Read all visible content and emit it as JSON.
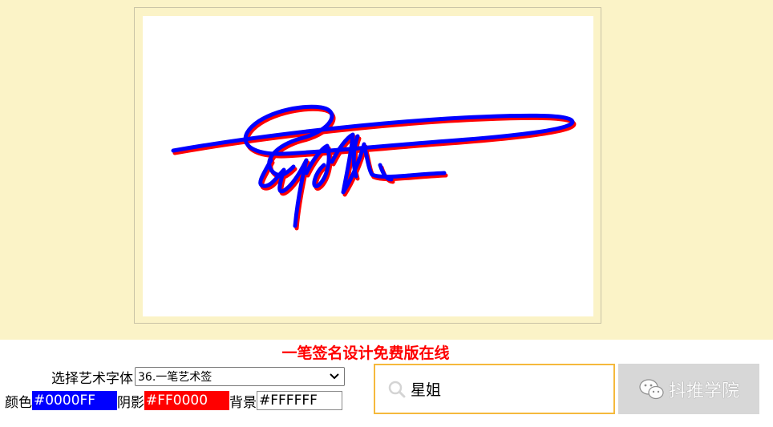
{
  "heading": "一笔签名设计免费版在线",
  "font_picker": {
    "label": "选择艺术字体",
    "selected": "36.一笔艺术签"
  },
  "colors": {
    "main_label": "颜色",
    "main_value": "#0000FF",
    "main_bg": "#0000ff",
    "shadow_label": "阴影",
    "shadow_value": "#FF0000",
    "shadow_bg": "#ff0000",
    "background_label": "背景",
    "background_value": "#FFFFFF"
  },
  "name_input": {
    "value": "星姐",
    "icon": "search-icon"
  },
  "watermark": {
    "text": "抖推学院",
    "icon": "wechat-icon"
  },
  "theme": {
    "page_bg": "#fbf3c7",
    "input_border": "#f5b93c",
    "button_bg": "#d7d7d7",
    "heading_color": "#ff0000"
  }
}
